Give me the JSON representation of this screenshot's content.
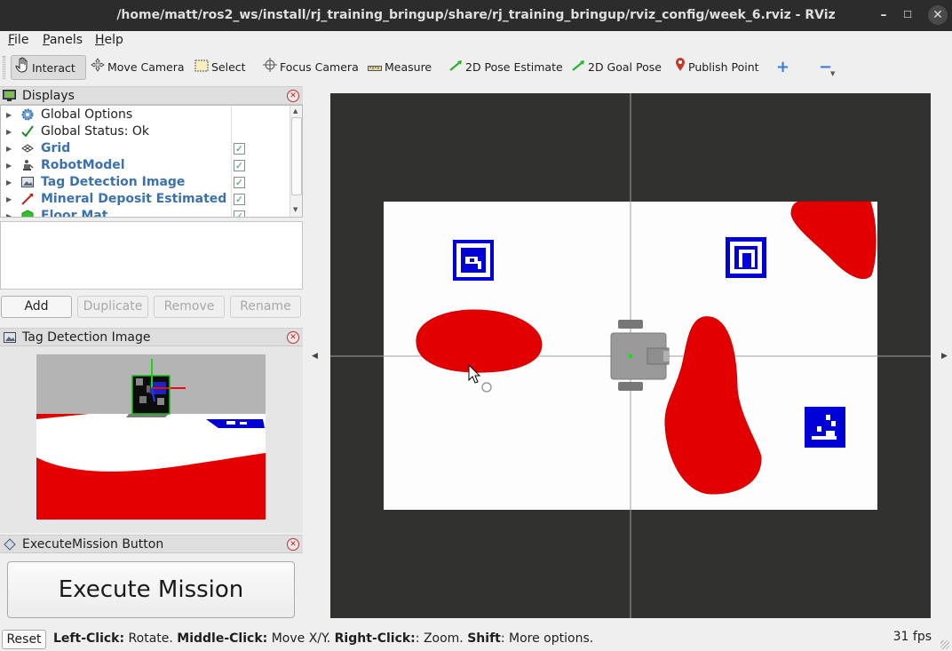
{
  "window": {
    "title": "/home/matt/ros2_ws/install/rj_training_bringup/share/rj_training_bringup/rviz_config/week_6.rviz - RViz"
  },
  "menubar": {
    "items": [
      {
        "pre": "",
        "key": "F",
        "post": "ile"
      },
      {
        "pre": "",
        "key": "P",
        "post": "anels"
      },
      {
        "pre": "",
        "key": "H",
        "post": "elp"
      }
    ]
  },
  "toolbar": {
    "tools": [
      {
        "label": "Interact",
        "icon": "hand-icon"
      },
      {
        "label": "Move Camera",
        "icon": "move-icon"
      },
      {
        "label": "Select",
        "icon": "select-icon"
      },
      {
        "label": "Focus Camera",
        "icon": "crosshair-icon"
      },
      {
        "label": "Measure",
        "icon": "ruler-icon"
      },
      {
        "label": "2D Pose Estimate",
        "icon": "green-arrow-icon"
      },
      {
        "label": "2D Goal Pose",
        "icon": "green-arrow-icon"
      },
      {
        "label": "Publish Point",
        "icon": "map-pin-icon"
      }
    ]
  },
  "displays_panel": {
    "title": "Displays",
    "items": [
      {
        "label": "Global Options",
        "icon": "gear-icon",
        "blue": false
      },
      {
        "label": "Global Status: Ok",
        "icon": "checkmark-icon",
        "blue": false
      },
      {
        "label": "Grid",
        "icon": "grid-icon",
        "blue": true,
        "checked": true
      },
      {
        "label": "RobotModel",
        "icon": "robot-icon",
        "blue": true,
        "checked": true
      },
      {
        "label": "Tag Detection Image",
        "icon": "image-icon",
        "blue": true,
        "checked": true
      },
      {
        "label": "Mineral Deposit Estimated ...",
        "icon": "pose-arrow-icon",
        "blue": true,
        "checked": true
      },
      {
        "label": "Floor Mat",
        "icon": "green-cube-icon",
        "blue": true,
        "checked": true
      }
    ],
    "buttons": {
      "add": "Add",
      "duplicate": "Duplicate",
      "remove": "Remove",
      "rename": "Rename"
    }
  },
  "tag_panel": {
    "title": "Tag Detection Image"
  },
  "execute_panel": {
    "title": "ExecuteMission Button",
    "button_label": "Execute Mission"
  },
  "statusbar": {
    "reset": "Reset",
    "hint": [
      {
        "b": "Left-Click:",
        "t": " Rotate. "
      },
      {
        "b": "Middle-Click:",
        "t": " Move X/Y. "
      },
      {
        "b": "Right-Click:",
        "t": ": Zoom. "
      },
      {
        "b": "Shift",
        "t": ": More options."
      }
    ],
    "fps": "31 fps"
  },
  "colors": {
    "deposit_red": "#e20000",
    "tag_blue": "#0000d8",
    "viewport_bg": "#31312f"
  }
}
